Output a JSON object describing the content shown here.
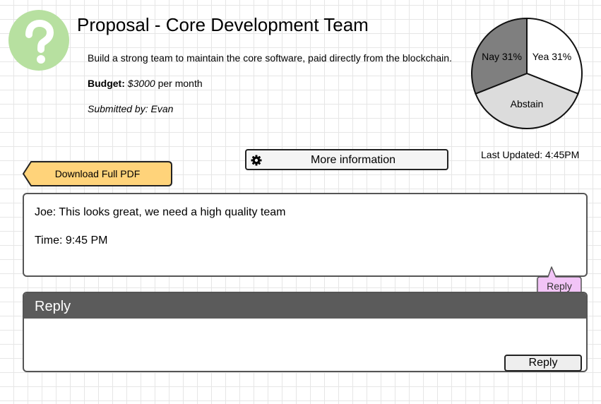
{
  "proposal": {
    "title": "Proposal - Core Development Team",
    "description": "Build a strong team to maintain the core software, paid directly from the blockchain.",
    "budget_label": "Budget:",
    "budget_amount": "$3000",
    "budget_period": "per month",
    "submitted_by": "Submitted by: Evan"
  },
  "logo": {
    "icon": "question-mark-icon",
    "color": "#b7e0a0"
  },
  "vote": {
    "chart_data": {
      "type": "pie",
      "slices": [
        {
          "label": "Yea 31%",
          "value": 31,
          "color": "#ffffff"
        },
        {
          "label": "Abstain",
          "value": 38,
          "color": "#dcdcdc"
        },
        {
          "label": "Nay 31%",
          "value": 31,
          "color": "#7f7f7f"
        }
      ]
    },
    "last_updated": "Last Updated: 4:45PM"
  },
  "actions": {
    "more_info_label": "More information",
    "more_info_icon": "gear-icon",
    "download_pdf_label": "Download Full PDF",
    "download_pdf_color": "#ffd37a"
  },
  "comments": [
    {
      "text": "Joe: This looks great, we need a high quality team",
      "time": "Time: 9:45 PM"
    }
  ],
  "reply_bubble": {
    "label": "Reply",
    "color": "#f2c4f7"
  },
  "reply_panel": {
    "header": "Reply",
    "value": "",
    "submit_label": "Reply"
  }
}
